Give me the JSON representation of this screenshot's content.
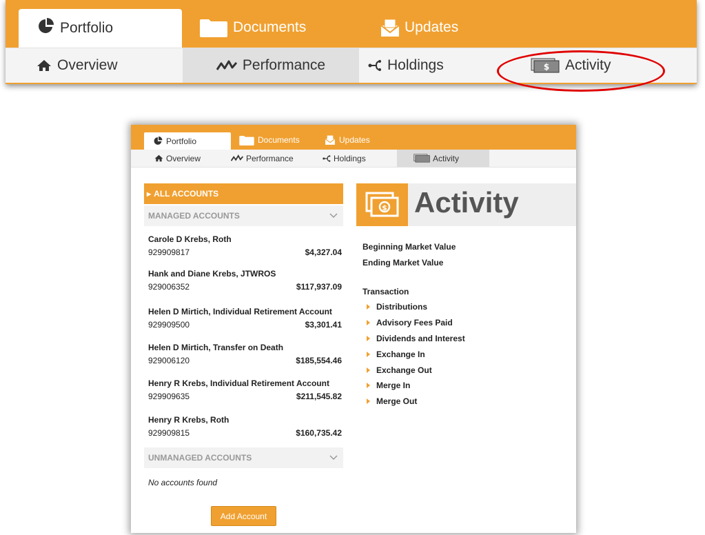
{
  "zoom": {
    "tabs": [
      "Portfolio",
      "Documents",
      "Updates"
    ],
    "subtabs": [
      "Overview",
      "Performance",
      "Holdings",
      "Activity"
    ]
  },
  "screen": {
    "tabs": [
      "Portfolio",
      "Documents",
      "Updates"
    ],
    "subtabs": [
      "Overview",
      "Performance",
      "Holdings",
      "Activity"
    ],
    "all_accounts": "ALL ACCOUNTS",
    "managed_header": "MANAGED ACCOUNTS",
    "accounts": [
      {
        "name": "Carole D Krebs, Roth",
        "number": "929909817",
        "balance": "$4,327.04"
      },
      {
        "name": "Hank and Diane Krebs, JTWROS",
        "number": "929006352",
        "balance": "$117,937.09"
      },
      {
        "name": "Helen D Mirtich, Individual Retirement Account",
        "number": "929909500",
        "balance": "$3,301.41"
      },
      {
        "name": "Helen D Mirtich, Transfer on Death",
        "number": "929006120",
        "balance": "$185,554.46"
      },
      {
        "name": "Henry R Krebs, Individual Retirement Account",
        "number": "929909635",
        "balance": "$211,545.82"
      },
      {
        "name": "Henry R Krebs, Roth",
        "number": "929909815",
        "balance": "$160,735.42"
      }
    ],
    "unmanaged_header": "UNMANAGED ACCOUNTS",
    "no_accounts": "No accounts found",
    "add_account": "Add Account",
    "activity_title": "Activity",
    "beginning_market_value": "Beginning Market Value",
    "ending_market_value": "Ending Market Value",
    "transaction_label": "Transaction",
    "transactions": [
      "Distributions",
      "Advisory Fees Paid",
      "Dividends and Interest",
      "Exchange In",
      "Exchange Out",
      "Merge In",
      "Merge Out"
    ]
  },
  "colors": {
    "accent": "#f0a030",
    "highlight": "#e00000"
  }
}
